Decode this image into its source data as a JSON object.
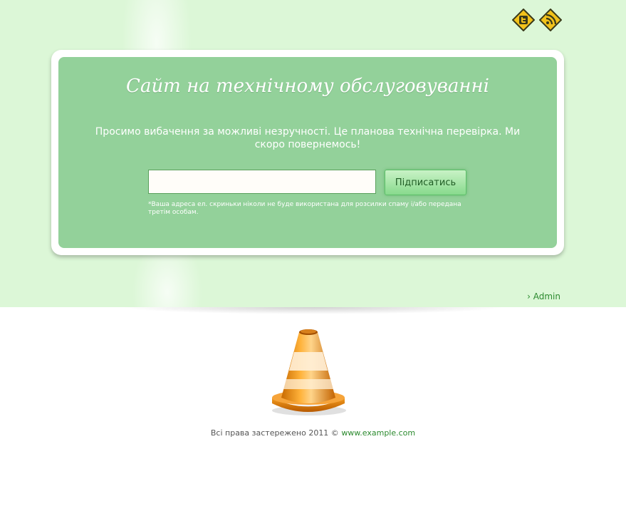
{
  "header": {
    "social_icons": [
      {
        "name": "twitter-icon",
        "color": "#f2c21b"
      },
      {
        "name": "rss-icon",
        "color": "#f2c21b"
      }
    ]
  },
  "maintenance": {
    "title": "Сайт на технічному обслуговуванні",
    "message": "Просимо вибачення за можливі незручності. Це планова технічна перевірка. Ми скоро повернемось!",
    "email_value": "",
    "subscribe_label": "Підписатись",
    "disclaimer": "*Ваша адреса ел. скриньки ніколи не буде використана для розсилки спаму і/або передана третім особам."
  },
  "admin_link": "› Admin",
  "footer": {
    "copyright": "Всі права застережено 2011 © ",
    "link_text": "www.example.com"
  },
  "colors": {
    "page_band": "#dcf7d7",
    "card": "#93d19a",
    "link": "#2b8a2e"
  }
}
